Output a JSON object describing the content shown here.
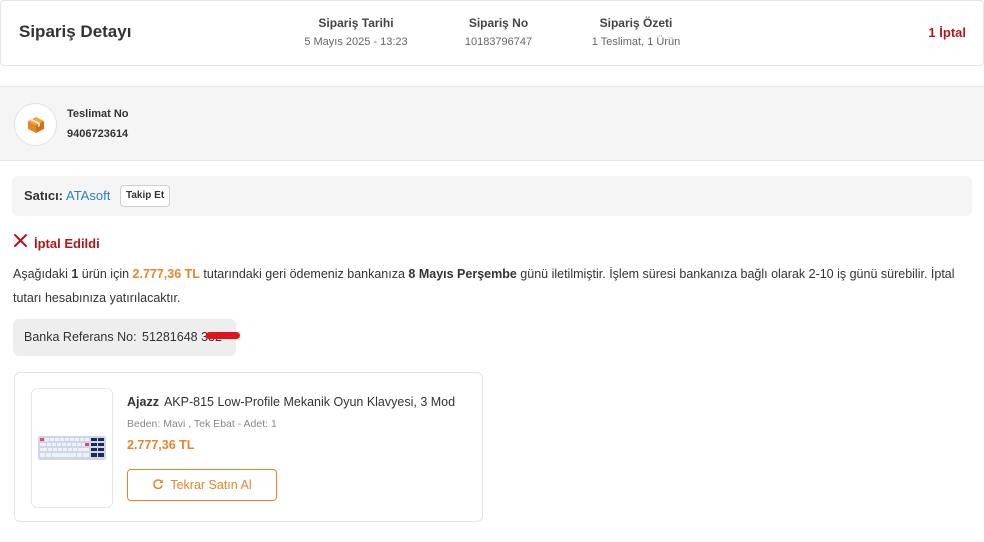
{
  "header": {
    "title": "Sipariş Detayı",
    "order_date_label": "Sipariş Tarihi",
    "order_date": "5 Mayıs 2025 - 13:23",
    "order_no_label": "Sipariş No",
    "order_no": "10183796747",
    "summary_label": "Sipariş Özeti",
    "summary": "1 Teslimat, 1 Ürün",
    "cancel_count": "1 İptal"
  },
  "delivery": {
    "label": "Teslimat No",
    "number": "9406723614",
    "icon": "package-box-icon"
  },
  "seller": {
    "label": "Satıcı:",
    "name": "ATAsoft",
    "follow_label": "Takip Et"
  },
  "status": {
    "icon": "close-x-icon",
    "text": "İptal Edildi"
  },
  "refund_info": {
    "part1": "Aşağıdaki ",
    "count": "1",
    "part2": " ürün için ",
    "amount": "2.777,36 TL",
    "part3": " tutarındaki geri ödemeniz bankanıza ",
    "date": "8 Mayıs Perşembe",
    "part4": " günü iletilmiştir. İşlem süresi bankanıza bağlı olarak 2-10 iş günü sürebilir. İptal tutarı hesabınıza yatırılacaktır."
  },
  "bank_ref": {
    "label": "Banka Referans No:",
    "value": "51281648 332"
  },
  "product": {
    "brand": "Ajazz",
    "name": "AKP-815 Low-Profile Mekanik Oyun Klavyesi, 3 Mod",
    "variant": "Beden: Mavi , Tek Ebat - Adet: 1",
    "price": "2.777,36 TL",
    "rebuy_label": "Tekrar Satın Al",
    "rebuy_icon": "refresh-icon"
  },
  "colors": {
    "accent": "#e5862a",
    "cancel_red": "#b0161d",
    "link_blue": "#2f7ec2"
  }
}
